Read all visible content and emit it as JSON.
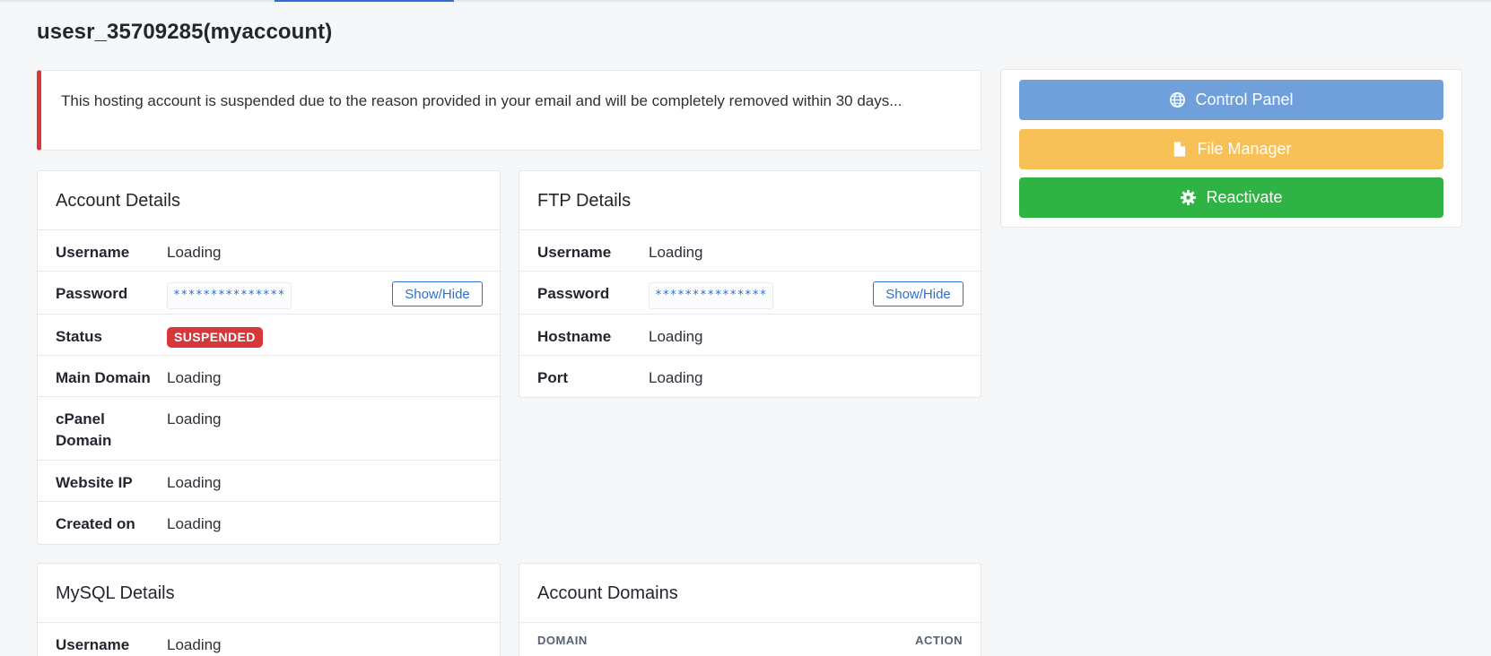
{
  "page": {
    "title": "usesr_35709285(myaccount)"
  },
  "alert": {
    "text": "This hosting account is suspended due to the reason provided in your email and will be completely removed within 30 days..."
  },
  "account_details": {
    "title": "Account Details",
    "rows": [
      {
        "label": "Username",
        "value": "Loading"
      },
      {
        "label": "Password",
        "value": "***************",
        "button": "Show/Hide"
      },
      {
        "label": "Status",
        "value": "SUSPENDED"
      },
      {
        "label": "Main Domain",
        "value": "Loading"
      },
      {
        "label": "cPanel Domain",
        "value": "Loading"
      },
      {
        "label": "Website IP",
        "value": "Loading"
      },
      {
        "label": "Created on",
        "value": "Loading"
      }
    ]
  },
  "ftp_details": {
    "title": "FTP Details",
    "rows": [
      {
        "label": "Username",
        "value": "Loading"
      },
      {
        "label": "Password",
        "value": "***************",
        "button": "Show/Hide"
      },
      {
        "label": "Hostname",
        "value": "Loading"
      },
      {
        "label": "Port",
        "value": "Loading"
      }
    ]
  },
  "mysql_details": {
    "title": "MySQL Details",
    "rows": [
      {
        "label": "Username",
        "value": "Loading"
      }
    ]
  },
  "account_domains": {
    "title": "Account Domains",
    "columns": [
      "DOMAIN",
      "ACTION"
    ]
  },
  "actions": {
    "control_panel": {
      "label": "Control Panel",
      "icon": "globe-icon",
      "color": "#6fa0db"
    },
    "file_manager": {
      "label": "File Manager",
      "icon": "file-icon",
      "color": "#f8c158"
    },
    "reactivate": {
      "label": "Reactivate",
      "icon": "gear-icon",
      "color": "#2fb344"
    }
  },
  "colors": {
    "accent": "#2f6fd1",
    "danger": "#d5373a"
  }
}
